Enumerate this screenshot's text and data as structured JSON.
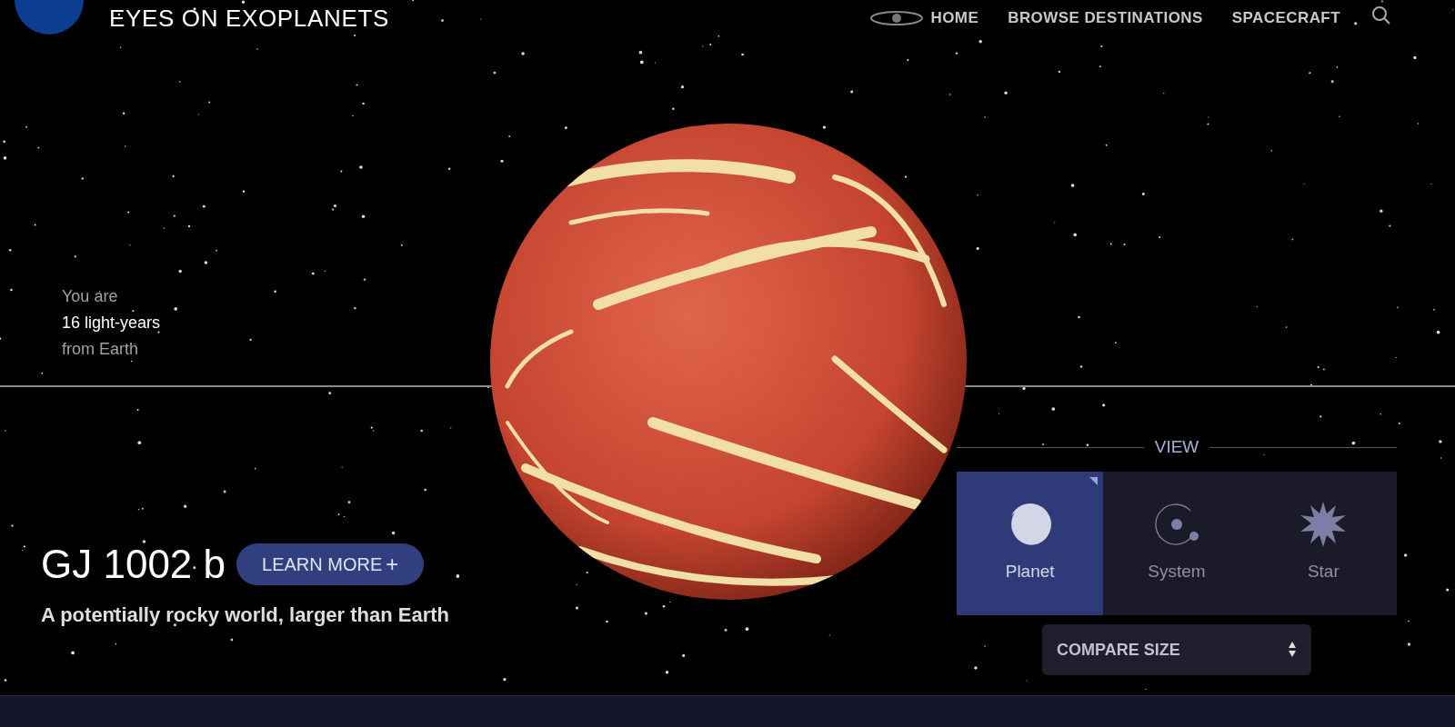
{
  "header": {
    "title": "EYES ON EXOPLANETS",
    "nav": [
      {
        "label": "HOME",
        "kind": "logo-link"
      },
      {
        "label": "BROWSE DESTINATIONS",
        "kind": "link"
      },
      {
        "label": "SPACECRAFT",
        "kind": "link"
      }
    ]
  },
  "distance": {
    "line_1": "You are",
    "line_2": "16 light-years",
    "line_3": "from Earth"
  },
  "planet": {
    "name": "GJ 1002 b",
    "learn_more": "LEARN MORE",
    "learn_more_icon": "+",
    "tagline": "A potentially rocky world, larger than Earth"
  },
  "view": {
    "label": "VIEW",
    "options": [
      {
        "label": "Planet",
        "kind": "planet",
        "selected": true
      },
      {
        "label": "System",
        "kind": "system",
        "selected": false
      },
      {
        "label": "Star",
        "kind": "star",
        "selected": false
      }
    ]
  },
  "compare": {
    "label": "COMPARE SIZE"
  }
}
